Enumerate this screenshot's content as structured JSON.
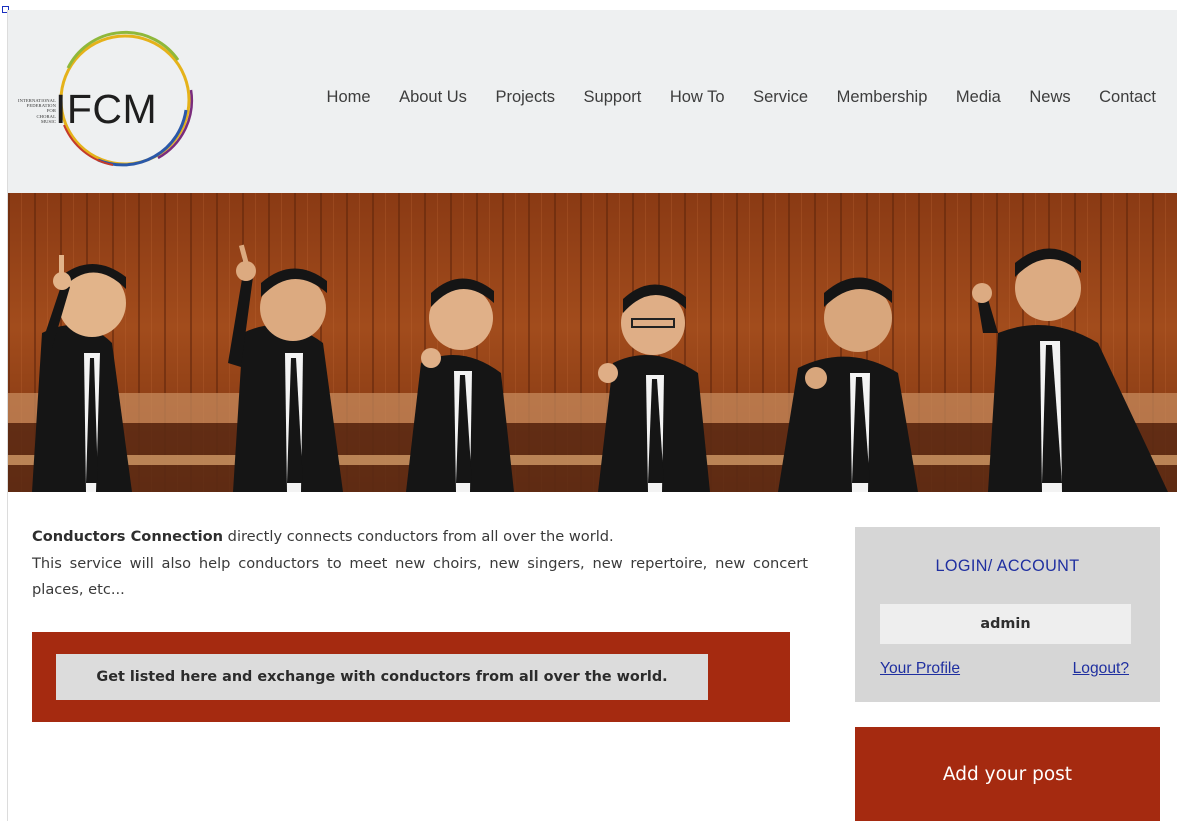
{
  "logo": {
    "ifcm": "IFCM",
    "line1": "INTERNATIONAL",
    "line2": "FEDERATION",
    "line3": "FOR",
    "line4": "CHORAL",
    "line5": "MUSIC"
  },
  "nav": {
    "items": [
      "Home",
      "About Us",
      "Projects",
      "Support",
      "How To",
      "Service",
      "Membership",
      "Media",
      "News",
      "Contact"
    ]
  },
  "intro": {
    "bold": "Conductors Connection",
    "line1_rest": " directly connects conductors from all over the world.",
    "line2": "This service will also help conductors to meet new choirs, new singers, new repertoire, new concert places, etc..."
  },
  "cta": {
    "label": "Get listed here and exchange with conductors from all over the world."
  },
  "login": {
    "title": "LOGIN/ ACCOUNT",
    "username": "admin",
    "profile_link": "Your Profile",
    "logout_link": "Logout?"
  },
  "post": {
    "label": "Add your post"
  },
  "colors": {
    "accent_red": "#a52a10",
    "link_blue": "#1f2fa0",
    "header_bg": "#eef0f1"
  }
}
